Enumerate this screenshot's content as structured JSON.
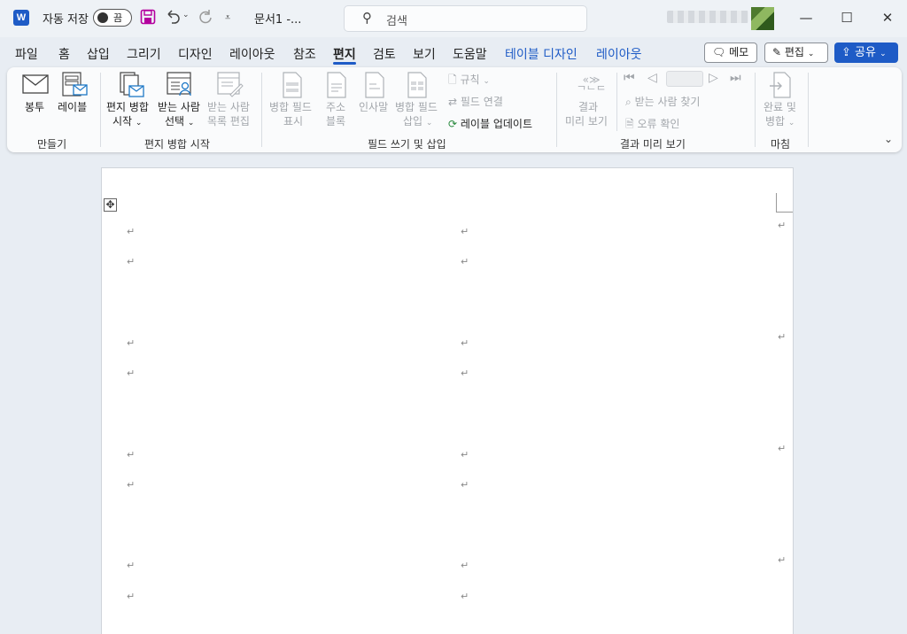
{
  "titlebar": {
    "autosave_label": "자동 저장",
    "autosave_state": "끔",
    "doc_title": "문서1  -...",
    "search_placeholder": "검색"
  },
  "tabs": [
    {
      "label": "파일"
    },
    {
      "label": "홈"
    },
    {
      "label": "삽입"
    },
    {
      "label": "그리기"
    },
    {
      "label": "디자인"
    },
    {
      "label": "레이아웃"
    },
    {
      "label": "참조"
    },
    {
      "label": "편지"
    },
    {
      "label": "검토"
    },
    {
      "label": "보기"
    },
    {
      "label": "도움말"
    },
    {
      "label": "테이블 디자인"
    },
    {
      "label": "레이아웃"
    }
  ],
  "header_buttons": {
    "memo": "메모",
    "edit": "편집",
    "share": "공유"
  },
  "ribbon": {
    "envelope": "봉투",
    "labels": "레이블",
    "group_create": "만들기",
    "start_mail_merge_1": "편지 병합",
    "start_mail_merge_2": "시작",
    "select_recipients_1": "받는 사람",
    "select_recipients_2": "선택",
    "edit_recipients_1": "받는 사람",
    "edit_recipients_2": "목록 편집",
    "group_start": "편지 병합 시작",
    "highlight_fields_1": "병합 필드",
    "highlight_fields_2": "표시",
    "address_block_1": "주소",
    "address_block_2": "블록",
    "greeting_line": "인사말",
    "insert_field_1": "병합 필드",
    "insert_field_2": "삽입",
    "rules": "규칙",
    "match_fields": "필드 연결",
    "update_labels": "레이블 업데이트",
    "group_write": "필드 쓰기 및 삽입",
    "preview_1": "결과",
    "preview_2": "미리 보기",
    "find_recipient": "받는 사람 찾기",
    "check_errors": "오류 확인",
    "group_preview": "결과 미리 보기",
    "finish_1": "완료 및",
    "finish_2": "병합",
    "group_finish": "마침"
  },
  "colors": {
    "accent": "#1e5bc6",
    "ribbon_bg": "#fafbfc",
    "app_bg": "#e8edf3",
    "disabled_text": "#a2a6ab"
  },
  "document": {
    "paragraph_mark": "↵",
    "move_handle": "✥"
  }
}
